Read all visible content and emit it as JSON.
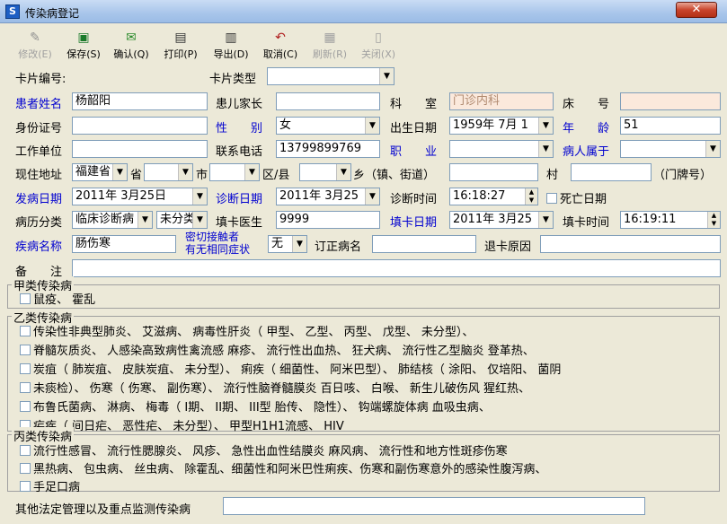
{
  "window": {
    "title": "传染病登记",
    "close": "✕"
  },
  "toolbar": [
    {
      "name": "modify-button",
      "label": "修改(E)",
      "icon": "pencil-icon",
      "enabled": false
    },
    {
      "name": "save-button",
      "label": "保存(S)",
      "icon": "floppy-icon",
      "enabled": true
    },
    {
      "name": "confirm-button",
      "label": "确认(Q)",
      "icon": "check-envelope-icon",
      "enabled": true
    },
    {
      "name": "print-button",
      "label": "打印(P)",
      "icon": "printer-icon",
      "enabled": true
    },
    {
      "name": "export-button",
      "label": "导出(D)",
      "icon": "export-printer-icon",
      "enabled": true
    },
    {
      "name": "cancel-button",
      "label": "取消(C)",
      "icon": "undo-icon",
      "enabled": true
    },
    {
      "name": "refresh-button",
      "label": "刷新(R)",
      "icon": "refresh-icon",
      "enabled": false
    },
    {
      "name": "close-window-button",
      "label": "关闭(X)",
      "icon": "door-icon",
      "enabled": false
    }
  ],
  "labels": {
    "card_no": "卡片编号:",
    "card_type": "卡片类型",
    "patient_name": "患者姓名",
    "guardian": "患儿家长",
    "department": "科　　室",
    "bed": "床　　号",
    "id_no": "身份证号",
    "gender": "性　　别",
    "birth_date": "出生日期",
    "age": "年　　龄",
    "work_unit": "工作单位",
    "phone": "联系电话",
    "occupation": "职　　业",
    "belong": "病人属于",
    "address": "现住地址",
    "province_suffix": "省",
    "city_suffix": "市",
    "county_suffix": "区/县",
    "town_suffix": "乡（镇、街道）",
    "village_suffix": "村",
    "house_no": "（门牌号）",
    "onset_date": "发病日期",
    "diagnosis_date": "诊断日期",
    "diagnosis_time": "诊断时间",
    "death_date": "死亡日期",
    "case_class": "病历分类",
    "doctor": "填卡医生",
    "fill_date": "填卡日期",
    "fill_time": "填卡时间",
    "disease_name": "疾病名称",
    "contact_line1": "密切接触者",
    "contact_line2": "有无相同症状",
    "revised_name": "订正病名",
    "return_reason": "退卡原因",
    "remark": "备　　注",
    "other": "其他法定管理以及重点监测传染病"
  },
  "values": {
    "card_no": "",
    "card_type": "",
    "patient_name": "杨韶阳",
    "guardian": "",
    "department": "门诊内科",
    "bed": "",
    "id_no": "",
    "gender": "女",
    "birth_date": "1959年 7月 1",
    "age": "51",
    "work_unit": "",
    "phone": "13799899769",
    "occupation": "",
    "belong": "",
    "province": "福建省",
    "city": "",
    "county": "",
    "town": "",
    "village": "",
    "house_no": "",
    "onset_date": "2011年 3月25日",
    "diagnosis_date": "2011年 3月25",
    "diagnosis_time": "16:18:27",
    "case_class1": "临床诊断病",
    "case_class2": "未分类",
    "doctor": "9999",
    "fill_date": "2011年 3月25",
    "fill_time": "16:19:11",
    "disease_name": "肠伤寒",
    "contact": "无",
    "revised_name": "",
    "return_reason": "",
    "remark": "",
    "other": ""
  },
  "groups": {
    "a_title": "甲类传染病",
    "a_lines": [
      "鼠疫、 霍乱"
    ],
    "b_title": "乙类传染病",
    "b_lines": [
      "传染性非典型肺炎、 艾滋病、 病毒性肝炎（ 甲型、 乙型、 丙型、 戊型、 未分型）、",
      "脊髓灰质炎、 人感染高致病性禽流感 麻疹、 流行性出血热、 狂犬病、 流行性乙型脑炎 登革热、",
      "炭疽（ 肺炭疽、 皮肤炭疽、 未分型）、 痢疾（ 细菌性、 阿米巴型）、 肺结核（ 涂阳、 仅培阳、 菌阴",
      "未痰检）、 伤寒（ 伤寒、 副伤寒）、 流行性脑脊髓膜炎 百日咳、 白喉、 新生儿破伤风 猩红热、",
      "布鲁氏菌病、 淋病、 梅毒（ I期、 II期、 III型 胎传、 隐性）、 钩端螺旋体病 血吸虫病、",
      "疟疾（ 间日疟、 恶性疟、 未分型）、 甲型H1H1流感、 HIV"
    ],
    "c_title": "丙类传染病",
    "c_lines": [
      "流行性感冒、 流行性腮腺炎、 风疹、 急性出血性结膜炎 麻风病、 流行性和地方性斑疹伤寒",
      "黑热病、 包虫病、 丝虫病、 除霍乱、细菌性和阿米巴性痢疾、伤寒和副伤寒意外的感染性腹泻病、",
      "手足口病"
    ]
  },
  "colors": {
    "title_bar": "#a8c5ea",
    "label_blue": "#0000d0",
    "window_bg": "#ece9d8",
    "dept_bg": "#fbe9dc"
  }
}
